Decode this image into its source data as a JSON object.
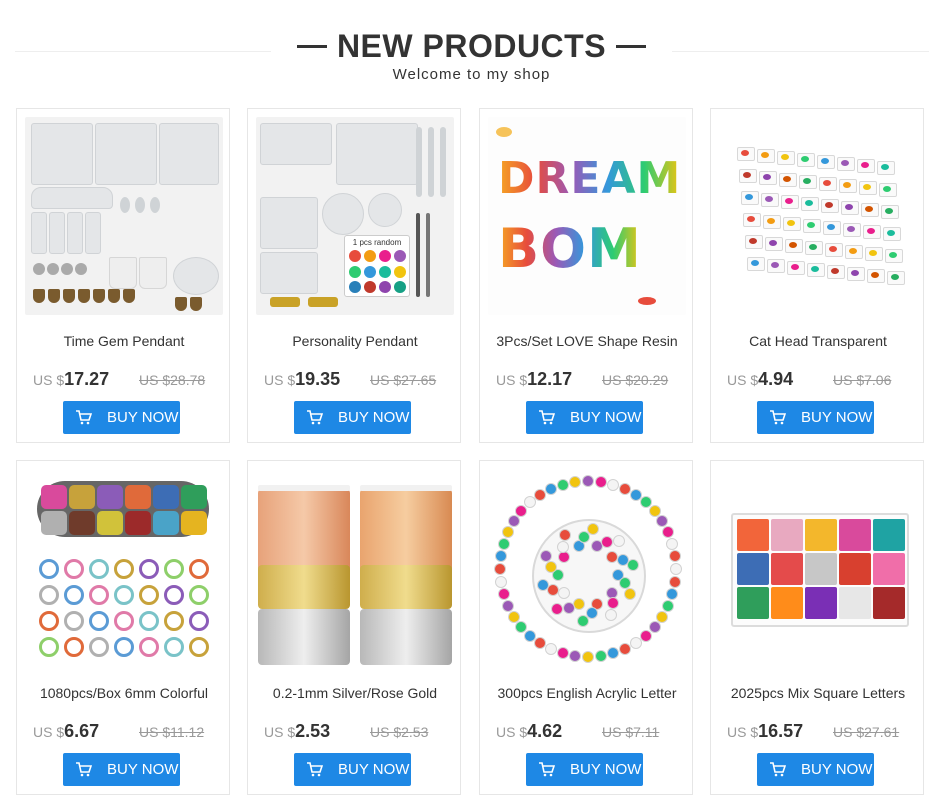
{
  "header": {
    "title": "NEW PRODUCTS",
    "subtitle": "Welcome to my shop"
  },
  "button_label": "BUY NOW",
  "accent_color": "#1e88e5",
  "products": [
    {
      "name": "Time Gem Pendant",
      "currency": "US $",
      "price": "17.27",
      "old_price": "US $28.78"
    },
    {
      "name": "Personality Pendant",
      "currency": "US $",
      "price": "19.35",
      "old_price": "US $27.65",
      "thumb_text": "1 pcs random"
    },
    {
      "name": "3Pcs/Set LOVE Shape Resin",
      "currency": "US $",
      "price": "12.17",
      "old_price": "US $20.29",
      "thumb_text_1": "DREAM",
      "thumb_text_2": "BOM"
    },
    {
      "name": "Cat Head Transparent",
      "currency": "US $",
      "price": "4.94",
      "old_price": "US $7.06"
    },
    {
      "name": "1080pcs/Box 6mm Colorful",
      "currency": "US $",
      "price": "6.67",
      "old_price": "US $11.12"
    },
    {
      "name": "0.2-1mm Silver/Rose Gold",
      "currency": "US $",
      "price": "2.53",
      "old_price": "US $2.53"
    },
    {
      "name": "300pcs English Acrylic Letter",
      "currency": "US $",
      "price": "4.62",
      "old_price": "US $7.11"
    },
    {
      "name": "2025pcs Mix Square Letters",
      "currency": "US $",
      "price": "16.57",
      "old_price": "US $27.61"
    }
  ]
}
